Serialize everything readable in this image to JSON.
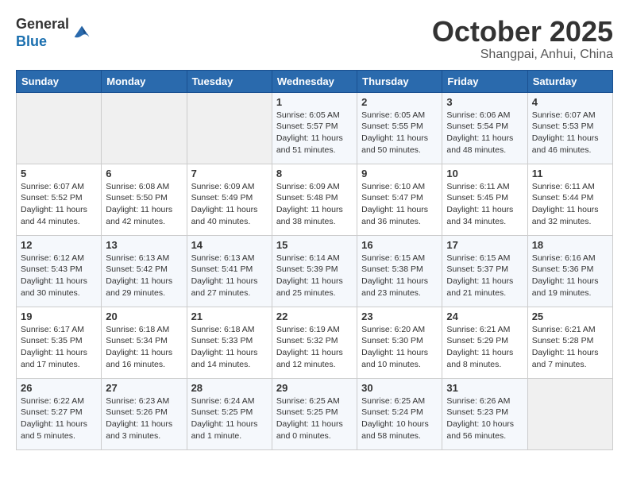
{
  "header": {
    "logo_line1": "General",
    "logo_line2": "Blue",
    "month": "October 2025",
    "location": "Shangpai, Anhui, China"
  },
  "weekdays": [
    "Sunday",
    "Monday",
    "Tuesday",
    "Wednesday",
    "Thursday",
    "Friday",
    "Saturday"
  ],
  "weeks": [
    [
      {
        "day": "",
        "info": ""
      },
      {
        "day": "",
        "info": ""
      },
      {
        "day": "",
        "info": ""
      },
      {
        "day": "1",
        "info": "Sunrise: 6:05 AM\nSunset: 5:57 PM\nDaylight: 11 hours\nand 51 minutes."
      },
      {
        "day": "2",
        "info": "Sunrise: 6:05 AM\nSunset: 5:55 PM\nDaylight: 11 hours\nand 50 minutes."
      },
      {
        "day": "3",
        "info": "Sunrise: 6:06 AM\nSunset: 5:54 PM\nDaylight: 11 hours\nand 48 minutes."
      },
      {
        "day": "4",
        "info": "Sunrise: 6:07 AM\nSunset: 5:53 PM\nDaylight: 11 hours\nand 46 minutes."
      }
    ],
    [
      {
        "day": "5",
        "info": "Sunrise: 6:07 AM\nSunset: 5:52 PM\nDaylight: 11 hours\nand 44 minutes."
      },
      {
        "day": "6",
        "info": "Sunrise: 6:08 AM\nSunset: 5:50 PM\nDaylight: 11 hours\nand 42 minutes."
      },
      {
        "day": "7",
        "info": "Sunrise: 6:09 AM\nSunset: 5:49 PM\nDaylight: 11 hours\nand 40 minutes."
      },
      {
        "day": "8",
        "info": "Sunrise: 6:09 AM\nSunset: 5:48 PM\nDaylight: 11 hours\nand 38 minutes."
      },
      {
        "day": "9",
        "info": "Sunrise: 6:10 AM\nSunset: 5:47 PM\nDaylight: 11 hours\nand 36 minutes."
      },
      {
        "day": "10",
        "info": "Sunrise: 6:11 AM\nSunset: 5:45 PM\nDaylight: 11 hours\nand 34 minutes."
      },
      {
        "day": "11",
        "info": "Sunrise: 6:11 AM\nSunset: 5:44 PM\nDaylight: 11 hours\nand 32 minutes."
      }
    ],
    [
      {
        "day": "12",
        "info": "Sunrise: 6:12 AM\nSunset: 5:43 PM\nDaylight: 11 hours\nand 30 minutes."
      },
      {
        "day": "13",
        "info": "Sunrise: 6:13 AM\nSunset: 5:42 PM\nDaylight: 11 hours\nand 29 minutes."
      },
      {
        "day": "14",
        "info": "Sunrise: 6:13 AM\nSunset: 5:41 PM\nDaylight: 11 hours\nand 27 minutes."
      },
      {
        "day": "15",
        "info": "Sunrise: 6:14 AM\nSunset: 5:39 PM\nDaylight: 11 hours\nand 25 minutes."
      },
      {
        "day": "16",
        "info": "Sunrise: 6:15 AM\nSunset: 5:38 PM\nDaylight: 11 hours\nand 23 minutes."
      },
      {
        "day": "17",
        "info": "Sunrise: 6:15 AM\nSunset: 5:37 PM\nDaylight: 11 hours\nand 21 minutes."
      },
      {
        "day": "18",
        "info": "Sunrise: 6:16 AM\nSunset: 5:36 PM\nDaylight: 11 hours\nand 19 minutes."
      }
    ],
    [
      {
        "day": "19",
        "info": "Sunrise: 6:17 AM\nSunset: 5:35 PM\nDaylight: 11 hours\nand 17 minutes."
      },
      {
        "day": "20",
        "info": "Sunrise: 6:18 AM\nSunset: 5:34 PM\nDaylight: 11 hours\nand 16 minutes."
      },
      {
        "day": "21",
        "info": "Sunrise: 6:18 AM\nSunset: 5:33 PM\nDaylight: 11 hours\nand 14 minutes."
      },
      {
        "day": "22",
        "info": "Sunrise: 6:19 AM\nSunset: 5:32 PM\nDaylight: 11 hours\nand 12 minutes."
      },
      {
        "day": "23",
        "info": "Sunrise: 6:20 AM\nSunset: 5:30 PM\nDaylight: 11 hours\nand 10 minutes."
      },
      {
        "day": "24",
        "info": "Sunrise: 6:21 AM\nSunset: 5:29 PM\nDaylight: 11 hours\nand 8 minutes."
      },
      {
        "day": "25",
        "info": "Sunrise: 6:21 AM\nSunset: 5:28 PM\nDaylight: 11 hours\nand 7 minutes."
      }
    ],
    [
      {
        "day": "26",
        "info": "Sunrise: 6:22 AM\nSunset: 5:27 PM\nDaylight: 11 hours\nand 5 minutes."
      },
      {
        "day": "27",
        "info": "Sunrise: 6:23 AM\nSunset: 5:26 PM\nDaylight: 11 hours\nand 3 minutes."
      },
      {
        "day": "28",
        "info": "Sunrise: 6:24 AM\nSunset: 5:25 PM\nDaylight: 11 hours\nand 1 minute."
      },
      {
        "day": "29",
        "info": "Sunrise: 6:25 AM\nSunset: 5:25 PM\nDaylight: 11 hours\nand 0 minutes."
      },
      {
        "day": "30",
        "info": "Sunrise: 6:25 AM\nSunset: 5:24 PM\nDaylight: 10 hours\nand 58 minutes."
      },
      {
        "day": "31",
        "info": "Sunrise: 6:26 AM\nSunset: 5:23 PM\nDaylight: 10 hours\nand 56 minutes."
      },
      {
        "day": "",
        "info": ""
      }
    ]
  ]
}
